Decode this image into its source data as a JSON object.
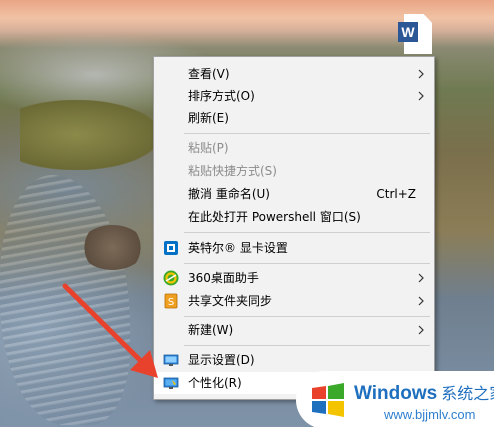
{
  "desktop": {
    "file_icon": "word-document-icon"
  },
  "menu": {
    "items": [
      {
        "label": "查看(V)",
        "submenu": true,
        "disabled": false,
        "icon": ""
      },
      {
        "label": "排序方式(O)",
        "submenu": true,
        "disabled": false,
        "icon": ""
      },
      {
        "label": "刷新(E)",
        "submenu": false,
        "disabled": false,
        "icon": ""
      },
      {
        "label": "粘贴(P)",
        "submenu": false,
        "disabled": true,
        "icon": ""
      },
      {
        "label": "粘贴快捷方式(S)",
        "submenu": false,
        "disabled": true,
        "icon": ""
      },
      {
        "label": "撤消 重命名(U)",
        "accelerator": "Ctrl+Z",
        "submenu": false,
        "disabled": false,
        "icon": ""
      },
      {
        "label": "在此处打开 Powershell 窗口(S)",
        "submenu": false,
        "disabled": false,
        "icon": ""
      },
      {
        "label": "英特尔® 显卡设置",
        "submenu": false,
        "disabled": false,
        "icon": "intel-graphics-icon"
      },
      {
        "label": "360桌面助手",
        "submenu": true,
        "disabled": false,
        "icon": "360-icon"
      },
      {
        "label": "共享文件夹同步",
        "submenu": true,
        "disabled": false,
        "icon": "share-sync-icon"
      },
      {
        "label": "新建(W)",
        "submenu": true,
        "disabled": false,
        "icon": ""
      },
      {
        "label": "显示设置(D)",
        "submenu": false,
        "disabled": false,
        "icon": "display-settings-icon"
      },
      {
        "label": "个性化(R)",
        "submenu": false,
        "disabled": false,
        "icon": "personalize-icon"
      }
    ]
  },
  "watermark": {
    "title": "Windows",
    "title_cn": "系统之家",
    "url": "www.bjjmlv.com"
  },
  "colors": {
    "menu_bg": "#f2f2f2",
    "annotation_arrow": "#e8412c",
    "watermark_blue": "#1f6fbf"
  }
}
